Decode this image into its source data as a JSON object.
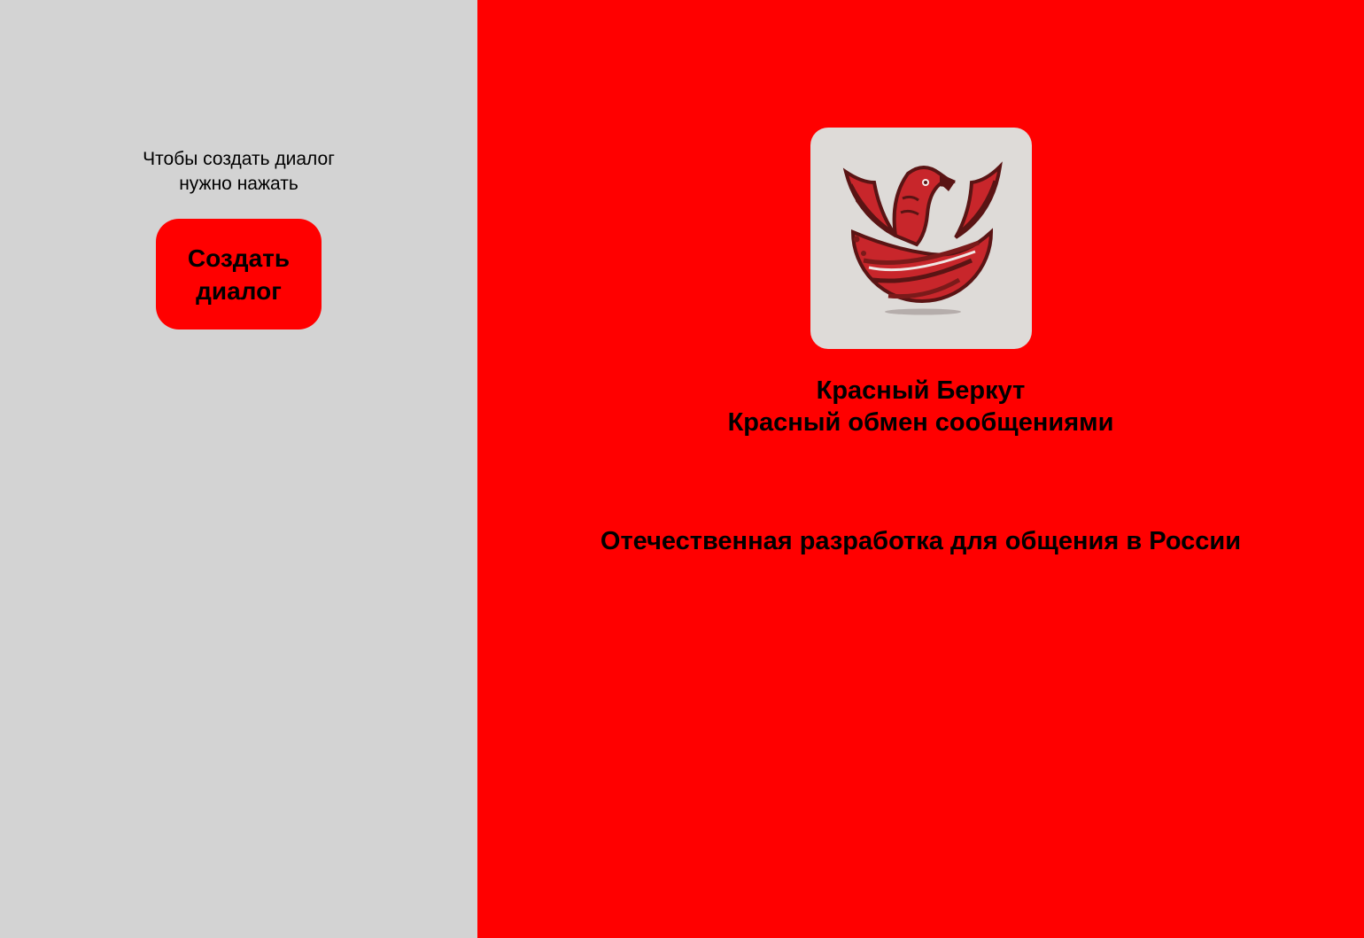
{
  "sidebar": {
    "hint_line1": "Чтобы создать диалог",
    "hint_line2": "нужно нажать",
    "create_button_line1": "Создать",
    "create_button_line2": "диалог"
  },
  "main": {
    "logo_icon": "red-eagle-logo-icon",
    "app_name": "Красный Беркут",
    "app_subtitle": "Красный обмен сообщениями",
    "tagline": "Отечественная разработка для общения в России"
  },
  "colors": {
    "sidebar_bg": "#d3d3d3",
    "accent": "#ff0000",
    "logo_bg": "#dedbd8",
    "logo_dark": "#5a1414",
    "logo_red": "#c8262b"
  }
}
